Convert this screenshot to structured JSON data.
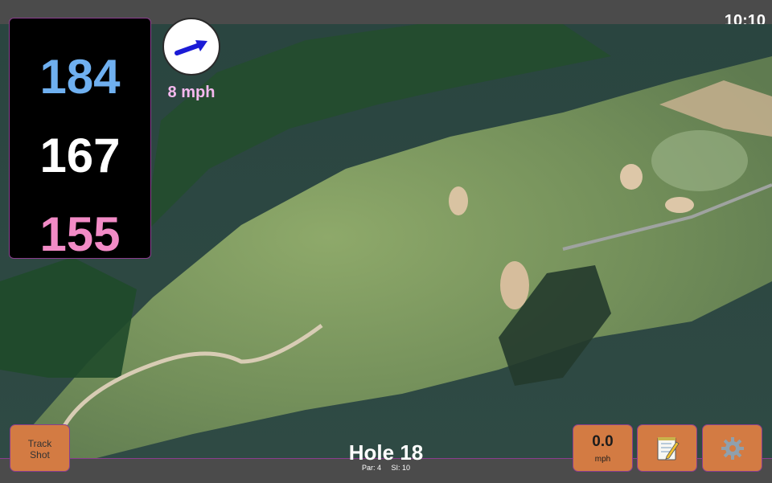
{
  "status": {
    "time": "10:10"
  },
  "distances": {
    "back": "184",
    "center": "167",
    "front": "155"
  },
  "wind": {
    "speed": "8 mph",
    "direction_icon": "wind-arrow-icon"
  },
  "hole": {
    "title": "Hole 18",
    "par": "Par: 4",
    "stroke_index": "SI: 10"
  },
  "buttons": {
    "track_shot": "Track\nShot",
    "speed_value": "0.0",
    "speed_unit": "mph",
    "notes_icon": "notepad-icon",
    "settings_icon": "gear-icon"
  },
  "colors": {
    "back_distance": "#6fb0f0",
    "center_distance": "#ffffff",
    "front_distance": "#f28bc6",
    "wind_text": "#f4b8ee",
    "button": "#d37b43",
    "accent_border": "#8b3d8e"
  }
}
